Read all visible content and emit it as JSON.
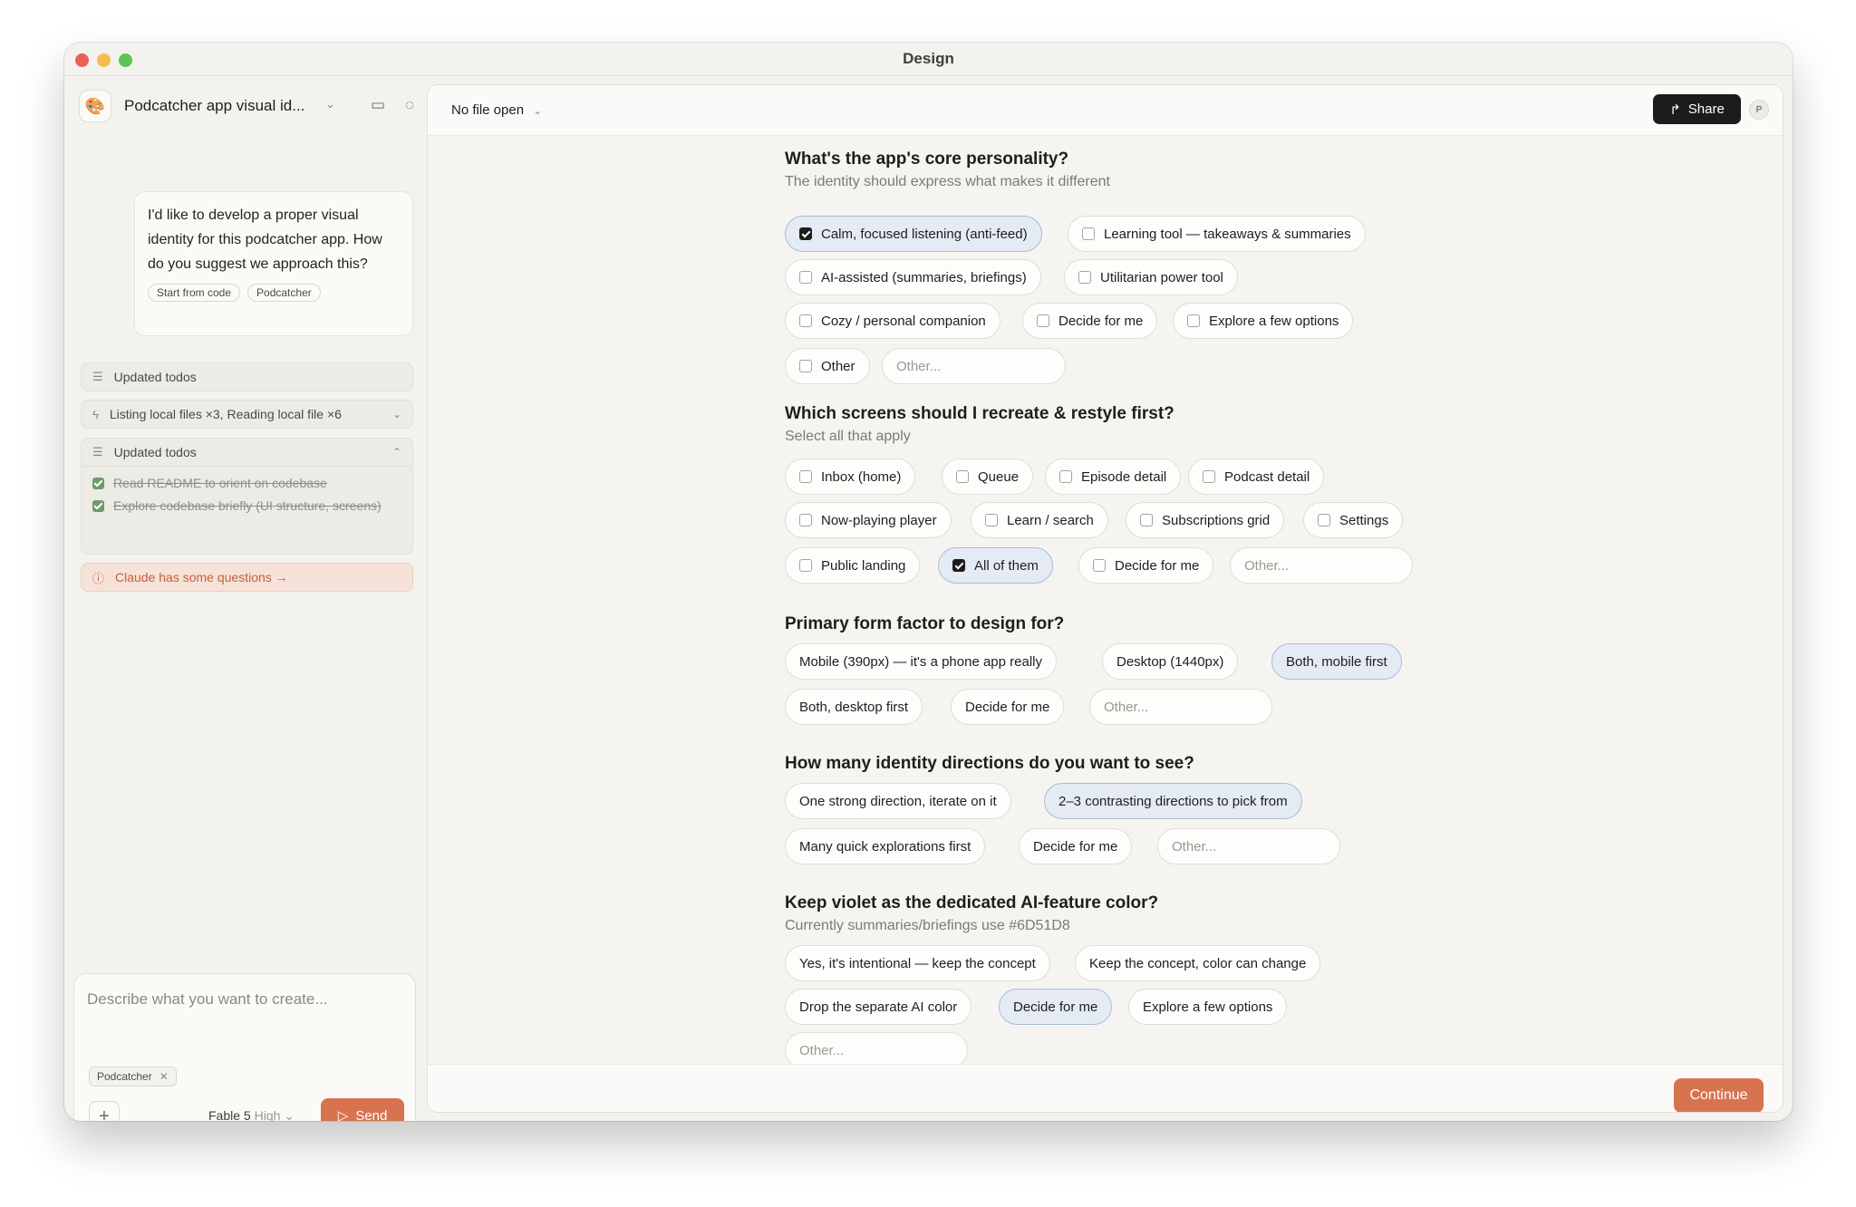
{
  "window": {
    "title": "Design"
  },
  "sidebar": {
    "project_name": "Podcatcher app visual id...",
    "user_message": "I'd like to develop a proper visual identity for this podcatcher app. How do you suggest we approach this?",
    "message_chips": [
      "Start from code",
      "Podcatcher"
    ],
    "activity": [
      {
        "label": "Updated todos"
      },
      {
        "label": "Listing local files ×3, Reading local file ×6"
      },
      {
        "label": "Updated todos"
      }
    ],
    "todos": [
      "Read README to orient on codebase",
      "Explore codebase briefly (UI structure, screens)"
    ],
    "questions_banner": "Claude has some questions →"
  },
  "composer": {
    "placeholder": "Describe what you want to create...",
    "chip": "Podcatcher",
    "model": "Fable 5",
    "effort": "High",
    "send_label": "Send"
  },
  "topbar": {
    "file_label": "No file open",
    "share_label": "Share",
    "avatar_initial": "P"
  },
  "questions": [
    {
      "title": "What's the app's core personality?",
      "subtitle": "The identity should express what makes it different",
      "options": [
        {
          "label": "Calm, focused listening (anti-feed)",
          "selected": true
        },
        {
          "label": "Learning tool — takeaways & summaries",
          "selected": false
        },
        {
          "label": "AI-assisted (summaries, briefings)",
          "selected": false
        },
        {
          "label": "Utilitarian power tool",
          "selected": false
        },
        {
          "label": "Cozy / personal companion",
          "selected": false
        },
        {
          "label": "Decide for me",
          "selected": false
        },
        {
          "label": "Explore a few options",
          "selected": false
        },
        {
          "label": "Other",
          "selected": false
        }
      ],
      "other_placeholder": "Other..."
    },
    {
      "title": "Which screens should I recreate & restyle first?",
      "subtitle": "Select all that apply",
      "options": [
        {
          "label": "Inbox (home)",
          "selected": false
        },
        {
          "label": "Queue",
          "selected": false
        },
        {
          "label": "Episode detail",
          "selected": false
        },
        {
          "label": "Podcast detail",
          "selected": false
        },
        {
          "label": "Now-playing player",
          "selected": false
        },
        {
          "label": "Learn / search",
          "selected": false
        },
        {
          "label": "Subscriptions grid",
          "selected": false
        },
        {
          "label": "Settings",
          "selected": false
        },
        {
          "label": "Public landing",
          "selected": false
        },
        {
          "label": "All of them",
          "selected": true
        },
        {
          "label": "Decide for me",
          "selected": false
        }
      ],
      "other_placeholder": "Other..."
    },
    {
      "title": "Primary form factor to design for?",
      "options": [
        {
          "label": "Mobile (390px) — it's a phone app really",
          "selected": false
        },
        {
          "label": "Desktop (1440px)",
          "selected": false
        },
        {
          "label": "Both, mobile first",
          "selected": true
        },
        {
          "label": "Both, desktop first",
          "selected": false
        },
        {
          "label": "Decide for me",
          "selected": false
        }
      ],
      "other_placeholder": "Other..."
    },
    {
      "title": "How many identity directions do you want to see?",
      "options": [
        {
          "label": "One strong direction, iterate on it",
          "selected": false
        },
        {
          "label": "2–3 contrasting directions to pick from",
          "selected": true
        },
        {
          "label": "Many quick explorations first",
          "selected": false
        },
        {
          "label": "Decide for me",
          "selected": false
        }
      ],
      "other_placeholder": "Other..."
    },
    {
      "title": "Keep violet as the dedicated AI-feature color?",
      "subtitle": "Currently summaries/briefings use #6D51D8",
      "options": [
        {
          "label": "Yes, it's intentional — keep the concept",
          "selected": false
        },
        {
          "label": "Keep the concept, color can change",
          "selected": false
        },
        {
          "label": "Drop the separate AI color",
          "selected": false
        },
        {
          "label": "Decide for me",
          "selected": true
        },
        {
          "label": "Explore a few options",
          "selected": false
        }
      ],
      "other_placeholder": "Other..."
    }
  ],
  "footer": {
    "continue_label": "Continue"
  },
  "colors": {
    "accent": "#d8734f",
    "selected_bg": "#e4ebf5",
    "selected_border": "#a9bcd6"
  }
}
